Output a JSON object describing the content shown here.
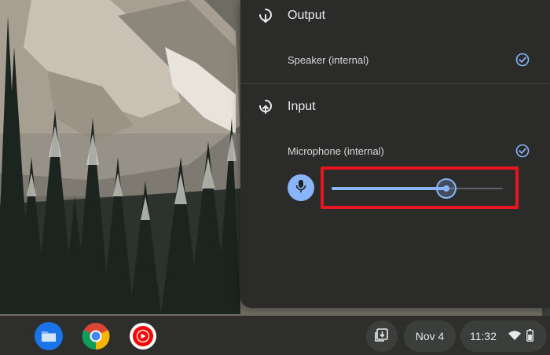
{
  "audio": {
    "output": {
      "title": "Output",
      "device": "Speaker (internal)",
      "selected": true
    },
    "input": {
      "title": "Input",
      "device": "Microphone (internal)",
      "selected": true,
      "gain_fraction": 0.67
    }
  },
  "shelf": {
    "apps": [
      {
        "name": "Files",
        "icon": "folder-icon"
      },
      {
        "name": "Chrome",
        "icon": "chrome-icon"
      },
      {
        "name": "YouTube Music",
        "icon": "youtube-music-icon"
      }
    ],
    "date": "Nov 4",
    "time": "11:32"
  },
  "colors": {
    "accent": "#8ab4f8",
    "panel_bg": "#2b2c2a",
    "highlight": "#e5161f"
  }
}
